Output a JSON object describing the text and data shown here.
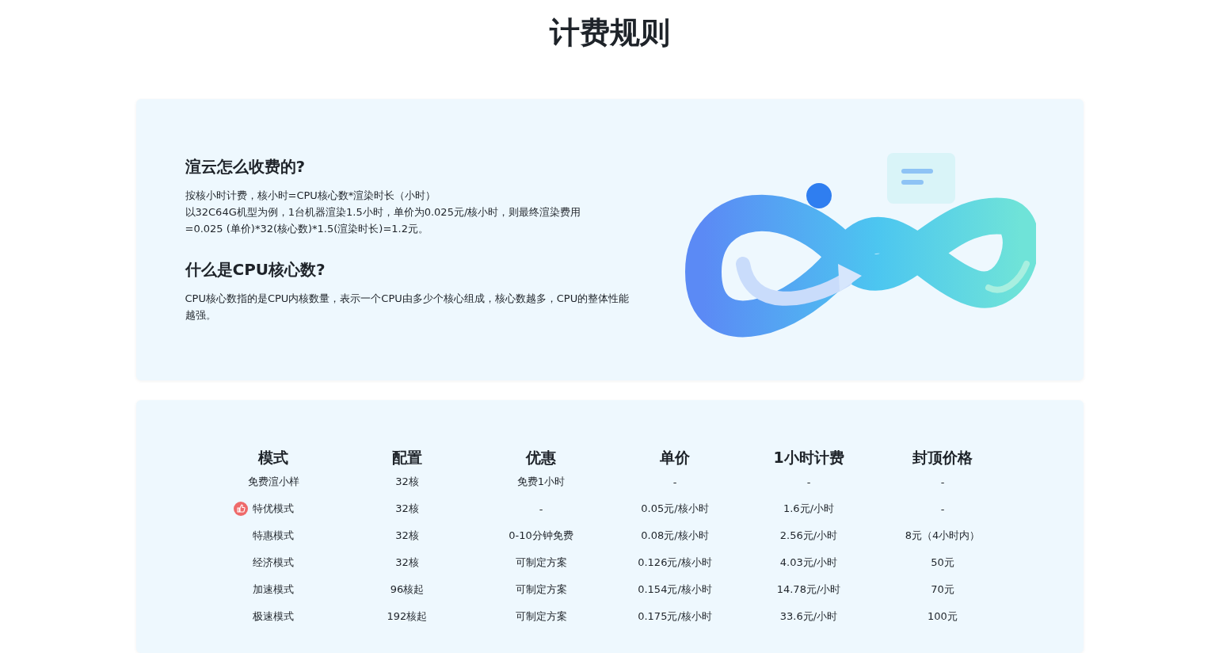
{
  "title": "计费规则",
  "intro": {
    "sections": [
      {
        "heading": "渲云怎么收费的?",
        "lines": [
          "按核小时计费，核小时=CPU核心数*渲染时长（小时）",
          "以32C64G机型为例，1台机器渲染1.5小时，单价为0.025元/核小时，则最终渲染费用",
          "=0.025 (单价)*32(核心数)*1.5(渲染时长)=1.2元。"
        ]
      },
      {
        "heading": "什么是CPU核心数?",
        "lines": [
          "CPU核心数指的是CPU内核数量，表示一个CPU由多少个核心组成，核心数越多，CPU的整体性能越强。"
        ]
      }
    ]
  },
  "table": {
    "columns": [
      "模式",
      "配置",
      "优惠",
      "单价",
      "1小时计费",
      "封顶价格"
    ],
    "rows": [
      {
        "recommended": false,
        "cells": [
          "免费渲小样",
          "32核",
          "免费1小时",
          "-",
          "-",
          "-"
        ]
      },
      {
        "recommended": true,
        "cells": [
          "特优模式",
          "32核",
          "-",
          "0.05元/核小时",
          "1.6元/小时",
          "-"
        ]
      },
      {
        "recommended": false,
        "cells": [
          "特惠模式",
          "32核",
          "0-10分钟免费",
          "0.08元/核小时",
          "2.56元/小时",
          "8元（4小时内）"
        ]
      },
      {
        "recommended": false,
        "cells": [
          "经济模式",
          "32核",
          "可制定方案",
          "0.126元/核小时",
          "4.03元/小时",
          "50元"
        ]
      },
      {
        "recommended": false,
        "cells": [
          "加速模式",
          "96核起",
          "可制定方案",
          "0.154元/核小时",
          "14.78元/小时",
          "70元"
        ]
      },
      {
        "recommended": false,
        "cells": [
          "极速模式",
          "192核起",
          "可制定方案",
          "0.175元/核小时",
          "33.6元/小时",
          "100元"
        ]
      }
    ]
  }
}
